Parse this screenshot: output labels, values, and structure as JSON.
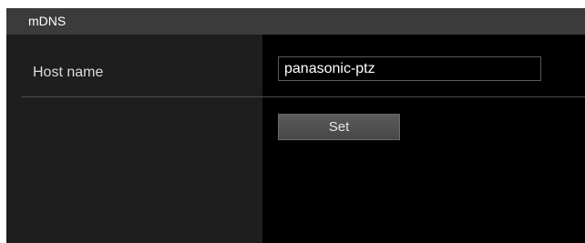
{
  "section": {
    "title": "mDNS"
  },
  "form": {
    "host_name_label": "Host name",
    "host_name_value": "panasonic-ptz",
    "set_label": "Set"
  },
  "colors": {
    "panel_background": "#000000",
    "header_background": "#3b3b3b",
    "label_column_background": "#1e1e1e",
    "button_background": "#4f4f4f"
  }
}
